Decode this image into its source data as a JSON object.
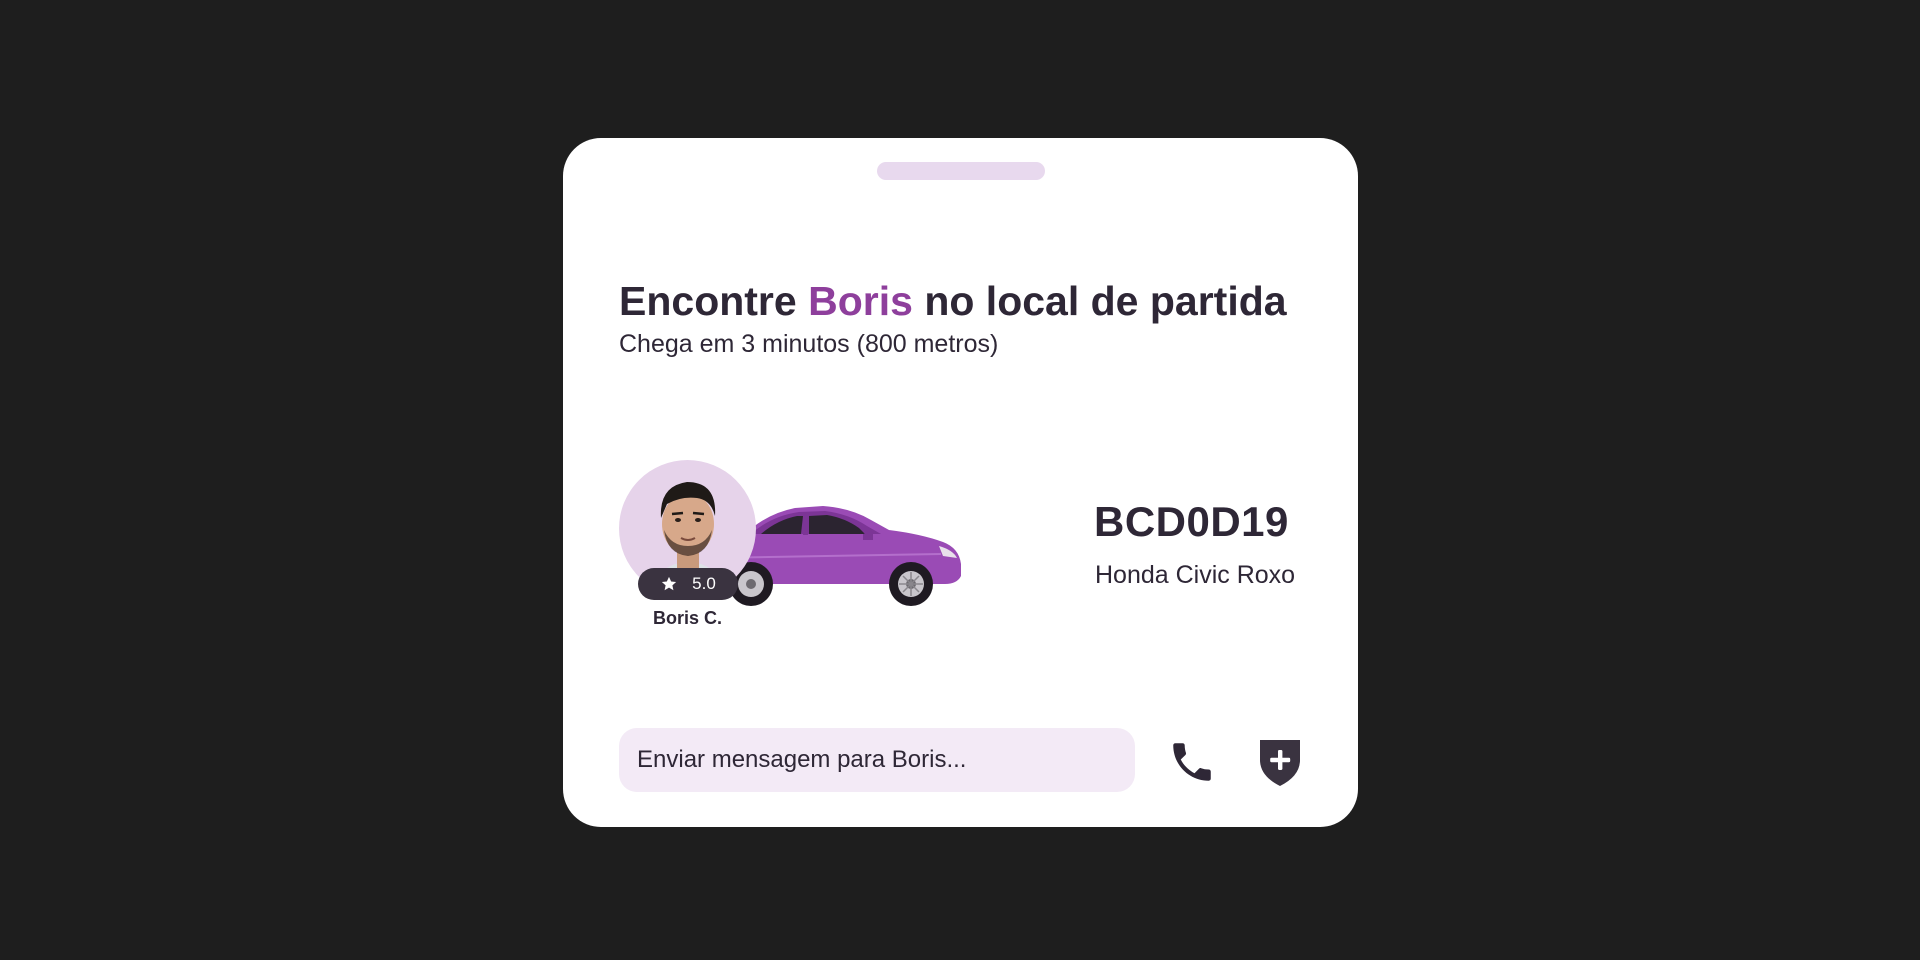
{
  "header": {
    "title_prefix": "Encontre",
    "title_name": "Boris",
    "title_suffix": "no local de partida",
    "subtitle": "Chega em 3 minutos (800 metros)"
  },
  "driver": {
    "name": "Boris C.",
    "rating": "5.0"
  },
  "vehicle": {
    "plate": "BCD0D19",
    "model": "Honda Civic Roxo"
  },
  "message": {
    "placeholder": "Enviar mensagem para Boris...",
    "value": ""
  },
  "actions": {
    "call_icon": "phone-icon",
    "safety_icon": "shield-plus-icon"
  },
  "colors": {
    "accent": "#8e3f9c",
    "text": "#2e2736",
    "background": "#1e1e1e",
    "card": "#ffffff",
    "input_bg": "#f3eaf6",
    "handle": "#e8d9ee",
    "car": "#9a4bb5"
  }
}
